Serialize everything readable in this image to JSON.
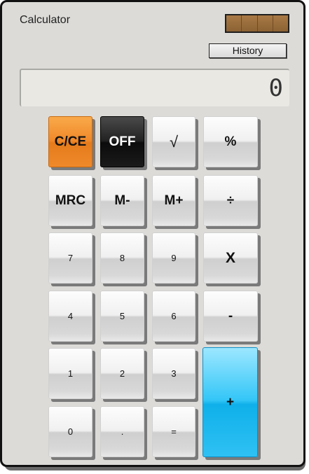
{
  "window": {
    "title": "Calculator"
  },
  "toolbar": {
    "history_label": "History"
  },
  "display": {
    "value": "0"
  },
  "colors": {
    "body": "#dcdbd8",
    "clear_button": "#f0892a",
    "off_button": "#111111",
    "plus_button": "#1fb8ef",
    "solar_panel": "#9a6d3a"
  },
  "keys": {
    "clear": "C/CE",
    "off": "OFF",
    "sqrt": "√",
    "percent": "%",
    "mrc": "MRC",
    "m_minus": "M-",
    "m_plus": "M+",
    "divide": "÷",
    "seven": "7",
    "eight": "8",
    "nine": "9",
    "multiply": "X",
    "four": "4",
    "five": "5",
    "six": "6",
    "minus": "-",
    "one": "1",
    "two": "2",
    "three": "3",
    "plus": "+",
    "zero": "0",
    "decimal": ".",
    "equals": "="
  }
}
